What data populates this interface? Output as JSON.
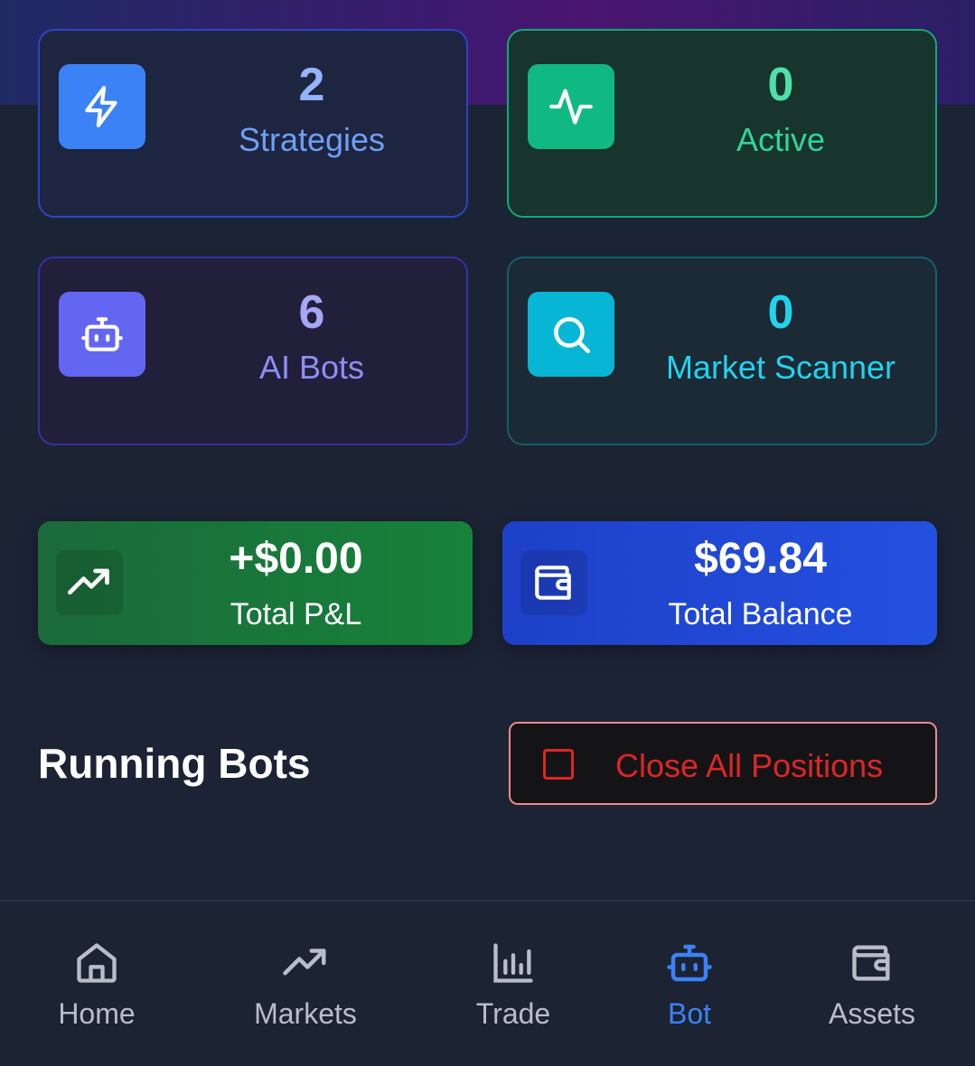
{
  "stats": [
    {
      "value": "2",
      "label": "Strategies",
      "icon": "lightning-icon"
    },
    {
      "value": "0",
      "label": "Active",
      "icon": "activity-icon"
    },
    {
      "value": "6",
      "label": "AI Bots",
      "icon": "bot-icon"
    },
    {
      "value": "0",
      "label": "Market Scanner",
      "icon": "search-icon"
    }
  ],
  "summary": {
    "pnl": {
      "value": "+$0.00",
      "label": "Total P&L",
      "icon": "trending-up-icon"
    },
    "balance": {
      "value": "$69.84",
      "label": "Total Balance",
      "icon": "wallet-icon"
    }
  },
  "running": {
    "title": "Running Bots",
    "close_all_label": "Close All Positions"
  },
  "nav": {
    "items": [
      {
        "label": "Home",
        "icon": "home-icon"
      },
      {
        "label": "Markets",
        "icon": "trending-up-icon"
      },
      {
        "label": "Trade",
        "icon": "bar-chart-icon"
      },
      {
        "label": "Bot",
        "icon": "bot-icon",
        "active": true
      },
      {
        "label": "Assets",
        "icon": "wallet-icon"
      }
    ]
  },
  "colors": {
    "accent": "#3b82f6",
    "danger": "#dc2626",
    "success": "#10b981",
    "scanner": "#06b6d4",
    "bots": "#6366f1"
  }
}
